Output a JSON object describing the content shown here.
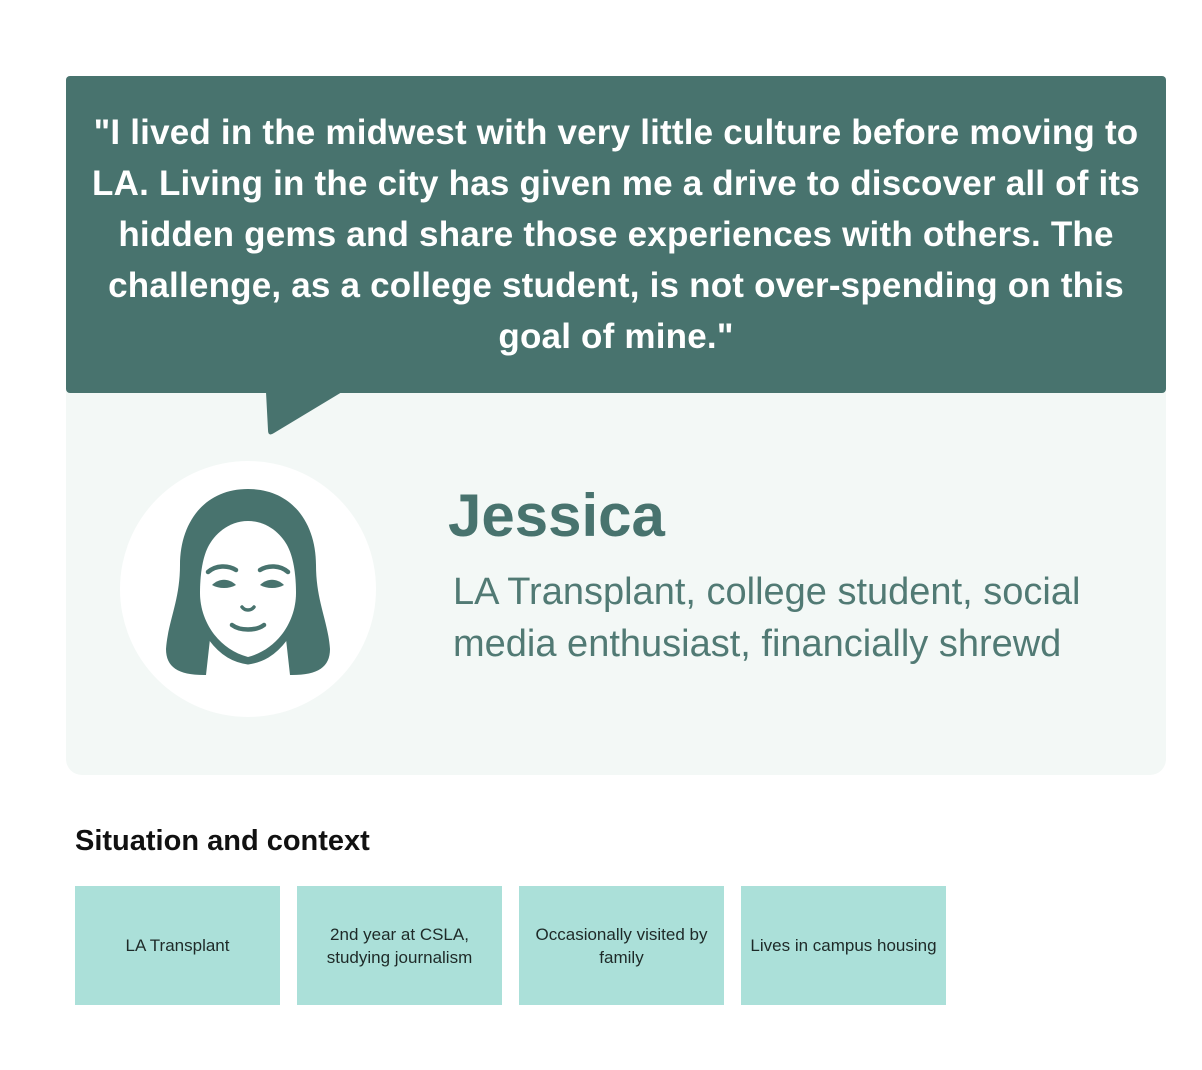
{
  "quote": {
    "text": "\"I lived in the midwest with very little culture before moving to LA. Living in the city has given me a drive to discover all of its hidden gems and share those experiences with others. The challenge, as a college student, is not over-spending on this goal of mine.\""
  },
  "persona": {
    "name": "Jessica",
    "tagline": "LA Transplant, college student, social media enthusiast, financially shrewd",
    "avatar_icon": "woman-face-icon"
  },
  "situation": {
    "heading": "Situation and context",
    "cards": [
      "LA Transplant",
      "2nd year at CSLA, studying journalism",
      "Occasionally visited by family",
      "Lives in campus housing"
    ]
  },
  "colors": {
    "primary": "#48736e",
    "card_background": "#f3f8f6",
    "context_card": "#abe0d9",
    "heading_text": "#111111"
  }
}
